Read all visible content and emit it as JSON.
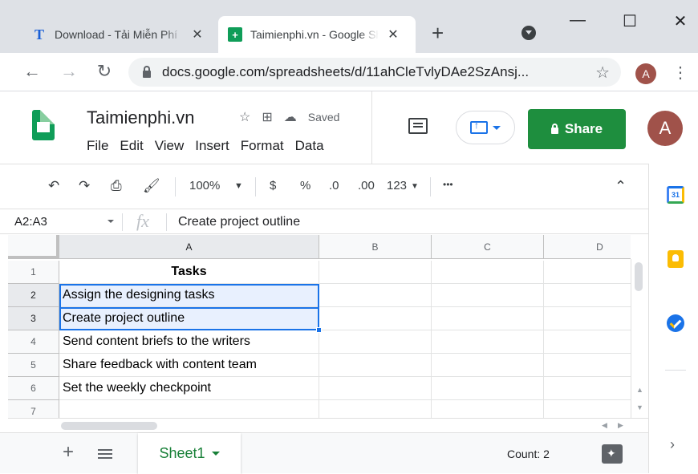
{
  "browser": {
    "tabs": [
      {
        "title": "Download - Tải Miễn Phí",
        "icon": "taimienphi-t-icon",
        "active": false
      },
      {
        "title": "Taimienphi.vn - Google Sheets",
        "icon": "google-sheets-icon",
        "active": true
      }
    ],
    "new_tab_label": "+",
    "url": "docs.google.com/spreadsheets/d/11ahCleTvlyDAe2SzAnsj...",
    "profile_initial": "A"
  },
  "doc": {
    "title": "Taimienphi.vn",
    "saved_status": "Saved",
    "menu": [
      "File",
      "Edit",
      "View",
      "Insert",
      "Format",
      "Data"
    ],
    "share_label": "Share",
    "avatar_initial": "A"
  },
  "toolbar": {
    "zoom": "100%",
    "currency": "$",
    "percent": "%",
    "decrease_decimal": ".0",
    "increase_decimal": ".00",
    "more_formats": "123",
    "more": "•••"
  },
  "formula_bar": {
    "name_box": "A2:A3",
    "fx": "fx",
    "formula": "Create project outline"
  },
  "grid": {
    "columns": [
      "A",
      "B",
      "C",
      "D"
    ],
    "rows": [
      "1",
      "2",
      "3",
      "4",
      "5",
      "6",
      "7"
    ],
    "cells": [
      "Tasks",
      "Assign the designing tasks",
      "Create project outline",
      "Send content briefs to the writers",
      "Share feedback with content team",
      "Set the weekly checkpoint",
      ""
    ],
    "selection": "A2:A3"
  },
  "bottom": {
    "sheet_name": "Sheet1",
    "count": "Count: 2"
  },
  "side_panel": {
    "calendar_day": "31"
  },
  "colors": {
    "sheets_green": "#0f9d58",
    "share_green": "#1e8e3e",
    "selection_blue": "#1a73e8",
    "selection_fill": "#e8f0fe"
  }
}
